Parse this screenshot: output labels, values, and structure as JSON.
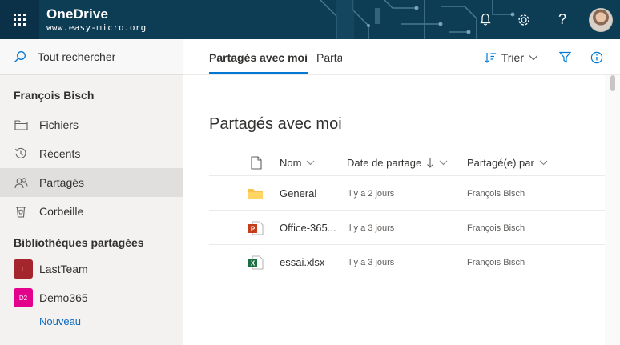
{
  "topbar": {
    "app_title": "OneDrive",
    "subtitle": "www.easy-micro.org",
    "icons": [
      "waffle-icon",
      "bell-icon",
      "gear-icon",
      "help-icon",
      "avatar"
    ]
  },
  "sidebar": {
    "search_label": "Tout rechercher",
    "user_name": "François Bisch",
    "items": [
      {
        "label": "Fichiers",
        "icon": "folder-icon"
      },
      {
        "label": "Récents",
        "icon": "history-icon"
      },
      {
        "label": "Partagés",
        "icon": "people-icon",
        "active": true
      },
      {
        "label": "Corbeille",
        "icon": "recycle-bin-icon"
      }
    ],
    "libraries_heading": "Bibliothèques partagées",
    "libraries": [
      {
        "badge": "L",
        "label": "LastTeam",
        "color": "#a4262c"
      },
      {
        "badge": "D2",
        "label": "Demo365",
        "color": "#e3008c"
      }
    ],
    "new_label": "Nouveau"
  },
  "commandbar": {
    "tabs": [
      {
        "label": "Partagés avec moi",
        "active": true
      },
      {
        "label": "Parta",
        "active": false
      }
    ],
    "sort_label": "Trier"
  },
  "main": {
    "title": "Partagés avec moi",
    "columns": {
      "name": "Nom",
      "date": "Date de partage",
      "shared_by": "Partagé(e) par"
    },
    "rows": [
      {
        "name": "General",
        "date": "Il y a 2 jours",
        "shared_by": "François Bisch",
        "type": "folder"
      },
      {
        "name": "Office-365...",
        "date": "Il y a 3 jours",
        "shared_by": "François Bisch",
        "type": "powerpoint"
      },
      {
        "name": "essai.xlsx",
        "date": "Il y a 3 jours",
        "shared_by": "François Bisch",
        "type": "excel"
      }
    ]
  },
  "colors": {
    "topbar": "#0d3d55",
    "accent": "#0078d4",
    "link": "#0f6cbd",
    "folder": "#f8c34a",
    "powerpoint": "#c43e1c",
    "excel": "#1d6f42"
  }
}
